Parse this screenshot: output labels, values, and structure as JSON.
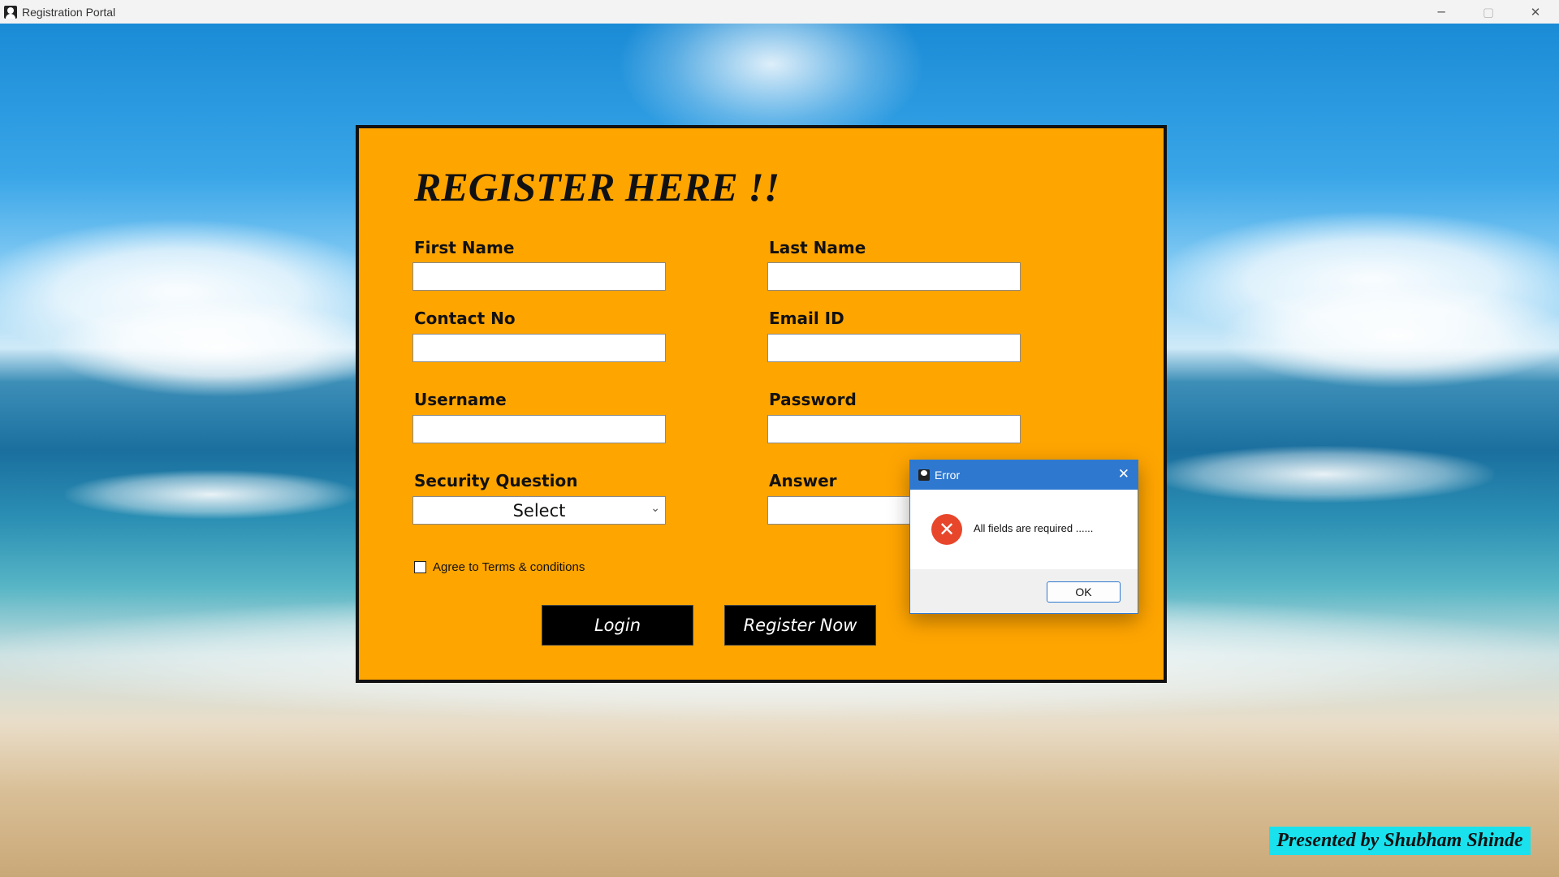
{
  "window": {
    "title": "Registration Portal",
    "controls": {
      "minimize": "─",
      "maximize": "▢",
      "close": "✕"
    }
  },
  "form": {
    "heading": "REGISTER HERE !!",
    "first_name_label": "First Name",
    "last_name_label": "Last Name",
    "contact_label": "Contact No",
    "email_label": "Email ID",
    "username_label": "Username",
    "password_label": "Password",
    "security_question_label": "Security Question",
    "answer_label": "Answer",
    "security_question_value": "Select",
    "terms_label": "Agree to Terms & conditions",
    "terms_checked": false,
    "login_button": "Login",
    "register_button": "Register Now",
    "panel_color": "#ffa500"
  },
  "dialog": {
    "title": "Error",
    "icon": "error-icon",
    "message": "All fields are required ......",
    "ok_button": "OK",
    "close_symbol": "✕",
    "error_symbol": "✕"
  },
  "credit": {
    "text": "Presented by Shubham Shinde",
    "color": "#19e2ee"
  }
}
